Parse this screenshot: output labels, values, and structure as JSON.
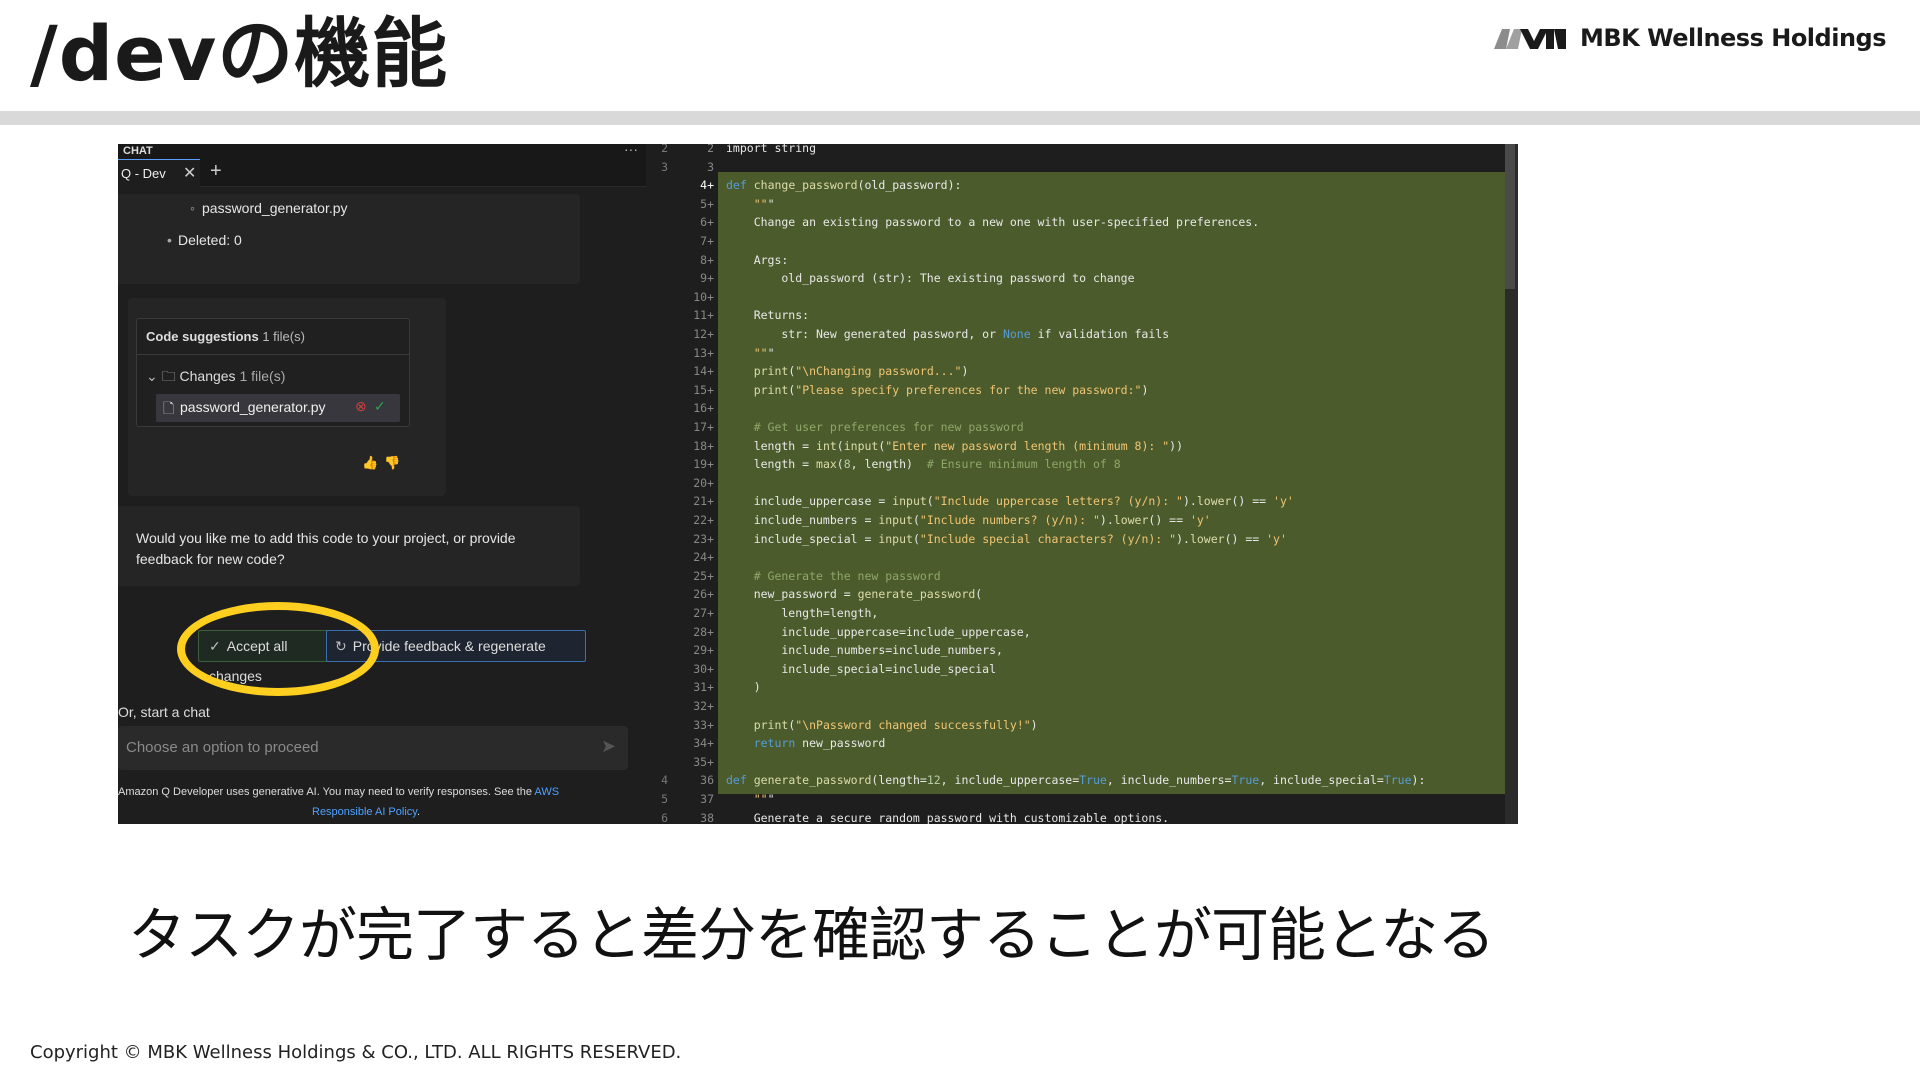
{
  "slide": {
    "title": "/devの機能",
    "brand": "MBK Wellness Holdings",
    "subtitle": "タスクが完了すると差分を確認することが可能となる",
    "copyright": "Copyright © MBK Wellness Holdings & CO., LTD. ALL RIGHTS RESERVED."
  },
  "chat": {
    "header": "CHAT",
    "menu_glyph": "···",
    "tab_label": "Q - Dev",
    "tab_close": "✕",
    "tab_add": "+",
    "file_item": "password_generator.py",
    "deleted_item": "Deleted: 0",
    "code_suggestions_label": "Code suggestions",
    "code_suggestions_count": "1 file(s)",
    "changes_label": "Changes",
    "changes_count": "1 file(s)",
    "changed_file": "password_generator.py",
    "question": "Would you like me to add this code to your project, or provide feedback for new code?",
    "accept_button": "Accept all changes",
    "regenerate_button": "Provide feedback & regenerate",
    "start_chat": "Or, start a chat",
    "input_placeholder": "Choose an option to proceed",
    "disclaimer_text": "Amazon Q Developer uses generative AI. You may need to verify responses. See the ",
    "disclaimer_link_1": "AWS",
    "disclaimer_link_2": "Responsible AI Policy",
    "disclaimer_end": "."
  },
  "code": {
    "lines": [
      {
        "old": "2",
        "new": "2",
        "text": "import string"
      },
      {
        "old": "3",
        "new": "3",
        "text": ""
      },
      {
        "old": "",
        "new": "4+",
        "text": "def change_password(old_password):"
      },
      {
        "old": "",
        "new": "5+",
        "text": "    \"\"\""
      },
      {
        "old": "",
        "new": "6+",
        "text": "    Change an existing password to a new one with user-specified preferences."
      },
      {
        "old": "",
        "new": "7+",
        "text": ""
      },
      {
        "old": "",
        "new": "8+",
        "text": "    Args:"
      },
      {
        "old": "",
        "new": "9+",
        "text": "        old_password (str): The existing password to change"
      },
      {
        "old": "",
        "new": "10+",
        "text": ""
      },
      {
        "old": "",
        "new": "11+",
        "text": "    Returns:"
      },
      {
        "old": "",
        "new": "12+",
        "text": "        str: New generated password, or None if validation fails"
      },
      {
        "old": "",
        "new": "13+",
        "text": "    \"\"\""
      },
      {
        "old": "",
        "new": "14+",
        "text": "    print(\"\\nChanging password...\")"
      },
      {
        "old": "",
        "new": "15+",
        "text": "    print(\"Please specify preferences for the new password:\")"
      },
      {
        "old": "",
        "new": "16+",
        "text": ""
      },
      {
        "old": "",
        "new": "17+",
        "text": "    # Get user preferences for new password"
      },
      {
        "old": "",
        "new": "18+",
        "text": "    length = int(input(\"Enter new password length (minimum 8): \"))"
      },
      {
        "old": "",
        "new": "19+",
        "text": "    length = max(8, length)  # Ensure minimum length of 8"
      },
      {
        "old": "",
        "new": "20+",
        "text": ""
      },
      {
        "old": "",
        "new": "21+",
        "text": "    include_uppercase = input(\"Include uppercase letters? (y/n): \").lower() == 'y'"
      },
      {
        "old": "",
        "new": "22+",
        "text": "    include_numbers = input(\"Include numbers? (y/n): \").lower() == 'y'"
      },
      {
        "old": "",
        "new": "23+",
        "text": "    include_special = input(\"Include special characters? (y/n): \").lower() == 'y'"
      },
      {
        "old": "",
        "new": "24+",
        "text": ""
      },
      {
        "old": "",
        "new": "25+",
        "text": "    # Generate the new password"
      },
      {
        "old": "",
        "new": "26+",
        "text": "    new_password = generate_password("
      },
      {
        "old": "",
        "new": "27+",
        "text": "        length=length,"
      },
      {
        "old": "",
        "new": "28+",
        "text": "        include_uppercase=include_uppercase,"
      },
      {
        "old": "",
        "new": "29+",
        "text": "        include_numbers=include_numbers,"
      },
      {
        "old": "",
        "new": "30+",
        "text": "        include_special=include_special"
      },
      {
        "old": "",
        "new": "31+",
        "text": "    )"
      },
      {
        "old": "",
        "new": "32+",
        "text": ""
      },
      {
        "old": "",
        "new": "33+",
        "text": "    print(\"\\nPassword changed successfully!\")"
      },
      {
        "old": "",
        "new": "34+",
        "text": "    return new_password"
      },
      {
        "old": "",
        "new": "35+",
        "text": ""
      },
      {
        "old": "4",
        "new": "36",
        "text": "def generate_password(length=12, include_uppercase=True, include_numbers=True, include_special=True):"
      },
      {
        "old": "5",
        "new": "37",
        "text": "    \"\"\""
      },
      {
        "old": "6",
        "new": "38",
        "text": "    Generate a secure random password with customizable options."
      }
    ]
  },
  "colors": {
    "highlight_ring": "#ffcf1f",
    "diff_added_bg": "#4b5b2c",
    "link": "#4ea1ff"
  }
}
